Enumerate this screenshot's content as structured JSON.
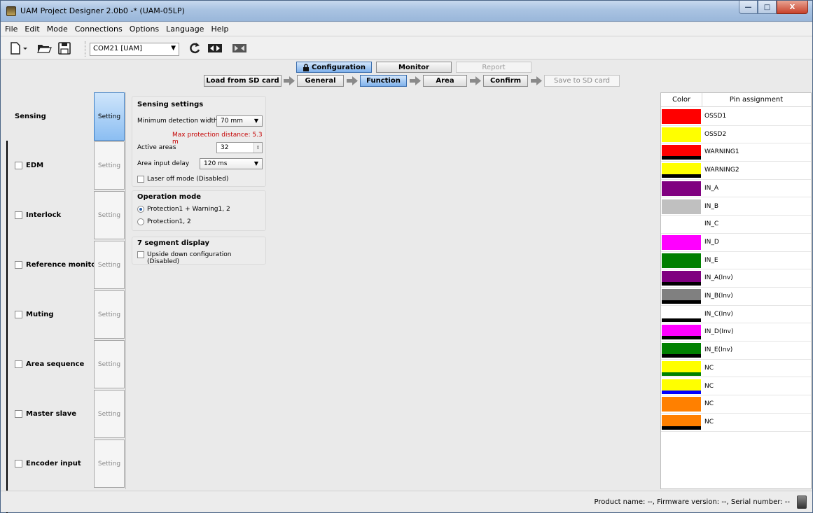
{
  "window": {
    "title": "UAM Project Designer 2.0b0 -* (UAM-05LP)",
    "controls": [
      "—",
      "□",
      "X"
    ]
  },
  "menu": [
    "File",
    "Edit",
    "Mode",
    "Connections",
    "Options",
    "Language",
    "Help"
  ],
  "toolbar": {
    "port": "COM21 [UAM]",
    "icons": [
      "new-file-icon",
      "open-folder-icon",
      "save-icon",
      "refresh-icon",
      "connect-icon",
      "disconnect-icon"
    ]
  },
  "mode_tabs": [
    {
      "label": "Configuration",
      "state": "active"
    },
    {
      "label": "Monitor",
      "state": "normal"
    },
    {
      "label": "Report",
      "state": "disabled"
    }
  ],
  "steps": [
    {
      "label": "Load from SD card",
      "state": "normal"
    },
    {
      "label": "General",
      "state": "normal"
    },
    {
      "label": "Function",
      "state": "active"
    },
    {
      "label": "Area",
      "state": "normal"
    },
    {
      "label": "Confirm",
      "state": "normal"
    },
    {
      "label": "Save to SD card",
      "state": "disabled"
    }
  ],
  "functions": [
    {
      "label": "Sensing",
      "checkbox": false,
      "setting": "Setting",
      "active": true
    },
    {
      "label": "EDM",
      "checkbox": true,
      "setting": "Setting",
      "active": false
    },
    {
      "label": "Interlock",
      "checkbox": true,
      "setting": "Setting",
      "active": false
    },
    {
      "label": "Reference monitor",
      "checkbox": true,
      "setting": "Setting",
      "active": false
    },
    {
      "label": "Muting",
      "checkbox": true,
      "setting": "Setting",
      "active": false
    },
    {
      "label": "Area sequence",
      "checkbox": true,
      "setting": "Setting",
      "active": false
    },
    {
      "label": "Master slave",
      "checkbox": true,
      "setting": "Setting",
      "active": false
    },
    {
      "label": "Encoder input",
      "checkbox": true,
      "setting": "Setting",
      "active": false
    }
  ],
  "sensing": {
    "title": "Sensing settings",
    "min_width_label": "Minimum detection width",
    "min_width_value": "70 mm",
    "max_distance_note": "Max protection distance: 5.3 m",
    "active_areas_label": "Active areas",
    "active_areas_value": "32",
    "input_delay_label": "Area input delay",
    "input_delay_value": "120 ms",
    "laser_off_label": "Laser off mode (Disabled)"
  },
  "operation": {
    "title": "Operation mode",
    "option1": "Protection1 + Warning1, 2",
    "option2": "Protection1, 2",
    "selected": 0
  },
  "segment": {
    "title": "7 segment display",
    "upside_label": "Upside down configuration (Disabled)"
  },
  "pin_table": {
    "col_color": "Color",
    "col_pin": "Pin assignment",
    "rows": [
      {
        "name": "OSSD1",
        "color": "#ff0000",
        "stripe": null
      },
      {
        "name": "OSSD2",
        "color": "#ffff00",
        "stripe": null
      },
      {
        "name": "WARNING1",
        "color": "#ff0000",
        "stripe": "#000000"
      },
      {
        "name": "WARNING2",
        "color": "#ffff00",
        "stripe": "#000000"
      },
      {
        "name": "IN_A",
        "color": "#800080",
        "stripe": null
      },
      {
        "name": "IN_B",
        "color": "#c0c0c0",
        "stripe": null
      },
      {
        "name": "IN_C",
        "color": "#ffffff",
        "stripe": null
      },
      {
        "name": "IN_D",
        "color": "#ff00ff",
        "stripe": null
      },
      {
        "name": "IN_E",
        "color": "#008000",
        "stripe": null
      },
      {
        "name": "IN_A(Inv)",
        "color": "#800080",
        "stripe": "#000000"
      },
      {
        "name": "IN_B(Inv)",
        "color": "#808080",
        "stripe": "#000000"
      },
      {
        "name": "IN_C(Inv)",
        "color": "#ffffff",
        "stripe": "#000000"
      },
      {
        "name": "IN_D(Inv)",
        "color": "#ff00ff",
        "stripe": "#000000"
      },
      {
        "name": "IN_E(Inv)",
        "color": "#008000",
        "stripe": "#000000"
      },
      {
        "name": "NC",
        "color": "#ffff00",
        "stripe": "#008000"
      },
      {
        "name": "NC",
        "color": "#ffff00",
        "stripe": "#0000ff"
      },
      {
        "name": "NC",
        "color": "#ff8000",
        "stripe": null
      },
      {
        "name": "NC",
        "color": "#ff8000",
        "stripe": "#000000"
      }
    ]
  },
  "status": {
    "text": "Product name: --, Firmware version: --, Serial number: --"
  }
}
